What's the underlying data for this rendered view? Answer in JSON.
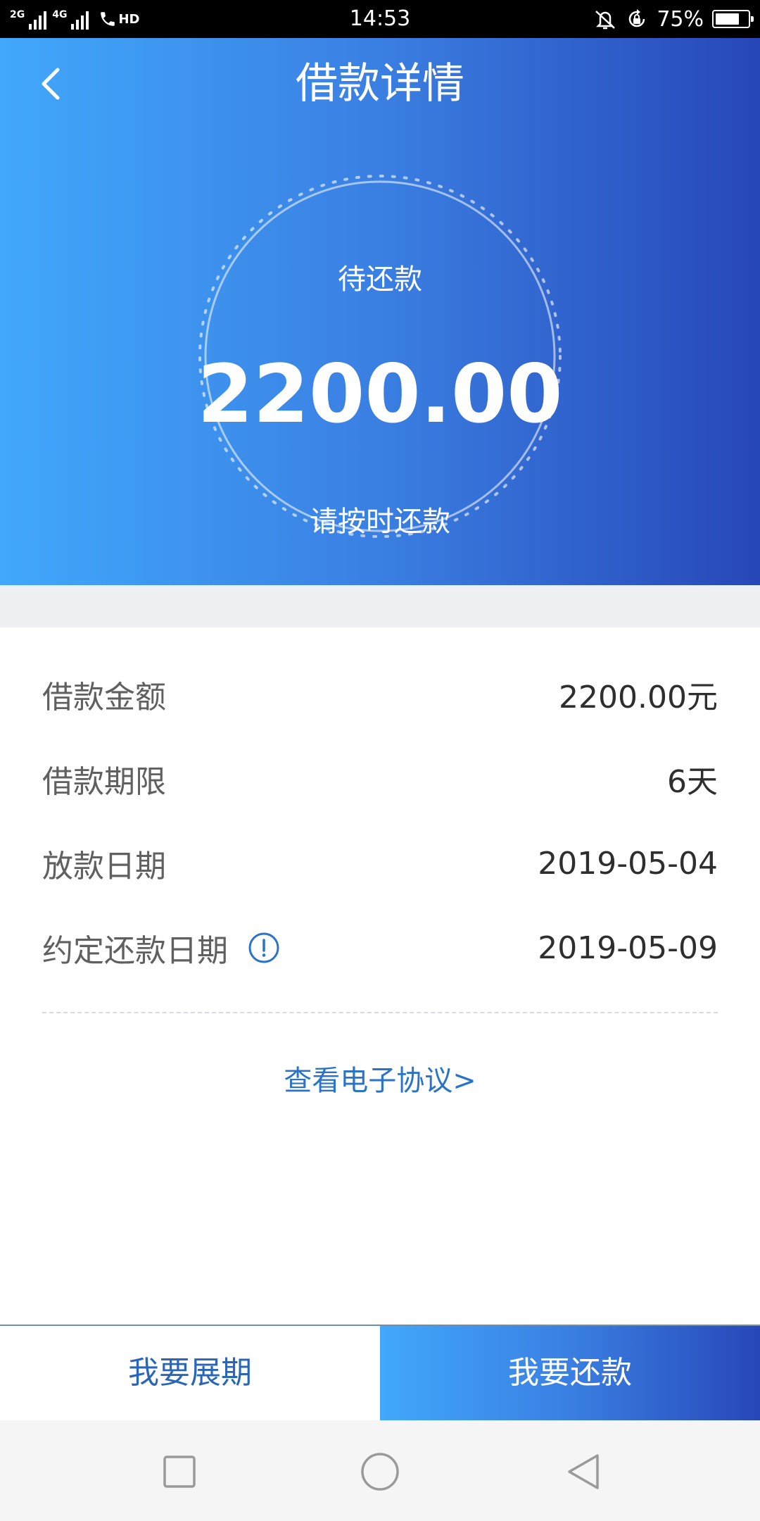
{
  "status_bar": {
    "network_1": "2G",
    "network_2": "4G",
    "call_label": "HD",
    "time": "14:53",
    "battery_percent": "75%",
    "battery_level": 0.75,
    "icons": [
      "signal-icon",
      "call-icon",
      "vibrate-icon",
      "rotation-lock-icon",
      "battery-icon"
    ]
  },
  "header": {
    "title": "借款详情",
    "back_icon": "chevron-left-icon"
  },
  "summary": {
    "label": "待还款",
    "amount": "2200.00",
    "hint": "请按时还款"
  },
  "details": {
    "rows": [
      {
        "label": "借款金额",
        "value": "2200.00元"
      },
      {
        "label": "借款期限",
        "value": "6天"
      },
      {
        "label": "放款日期",
        "value": "2019-05-04"
      },
      {
        "label": "约定还款日期",
        "value": "2019-05-09",
        "icon": "info-icon"
      }
    ]
  },
  "agreement_link": "查看电子协议>",
  "actions": {
    "extend": "我要展期",
    "repay": "我要还款"
  },
  "colors": {
    "gradient_start": "#41a8fb",
    "gradient_end": "#2747b8",
    "link": "#2a74c8",
    "label_text": "#606060",
    "value_text": "#2e2e2e",
    "page_gap": "#eef0f4"
  },
  "nav_bar": {
    "icons": [
      "recent-apps-icon",
      "home-icon",
      "back-triangle-icon"
    ]
  }
}
